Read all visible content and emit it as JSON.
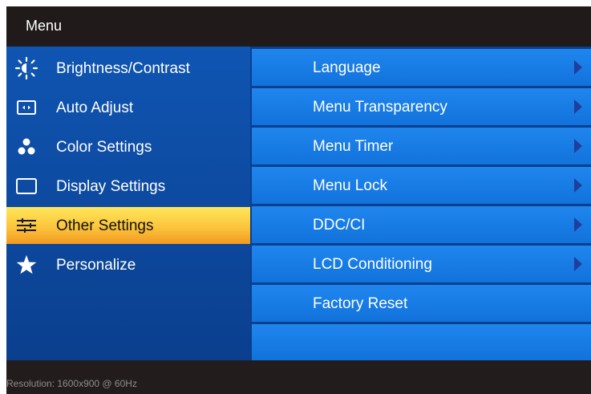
{
  "title": "Menu",
  "left_menu": [
    {
      "label": "Brightness/Contrast",
      "icon": "brightness-icon"
    },
    {
      "label": "Auto Adjust",
      "icon": "auto-adjust-icon"
    },
    {
      "label": "Color Settings",
      "icon": "color-dots-icon"
    },
    {
      "label": "Display Settings",
      "icon": "display-rectangle-icon"
    },
    {
      "label": "Other Settings",
      "icon": "sliders-icon",
      "selected": true
    },
    {
      "label": "Personalize",
      "icon": "star-icon"
    }
  ],
  "right_menu": [
    {
      "label": "Language",
      "has_submenu": true
    },
    {
      "label": "Menu Transparency",
      "has_submenu": true
    },
    {
      "label": "Menu Timer",
      "has_submenu": true
    },
    {
      "label": "Menu Lock",
      "has_submenu": true
    },
    {
      "label": "DDC/CI",
      "has_submenu": true
    },
    {
      "label": "LCD Conditioning",
      "has_submenu": true
    },
    {
      "label": "Factory Reset",
      "has_submenu": false
    }
  ],
  "status": "Resolution:  1600x900 @ 60Hz",
  "colors": {
    "title_bg": "#211a1a",
    "left_bg": "#0f55b2",
    "right_item_bg": "#1f86ee",
    "selected_bg": "#fbc43c",
    "arrow": "#1e3f9e",
    "status_text": "#8d8d8d"
  }
}
